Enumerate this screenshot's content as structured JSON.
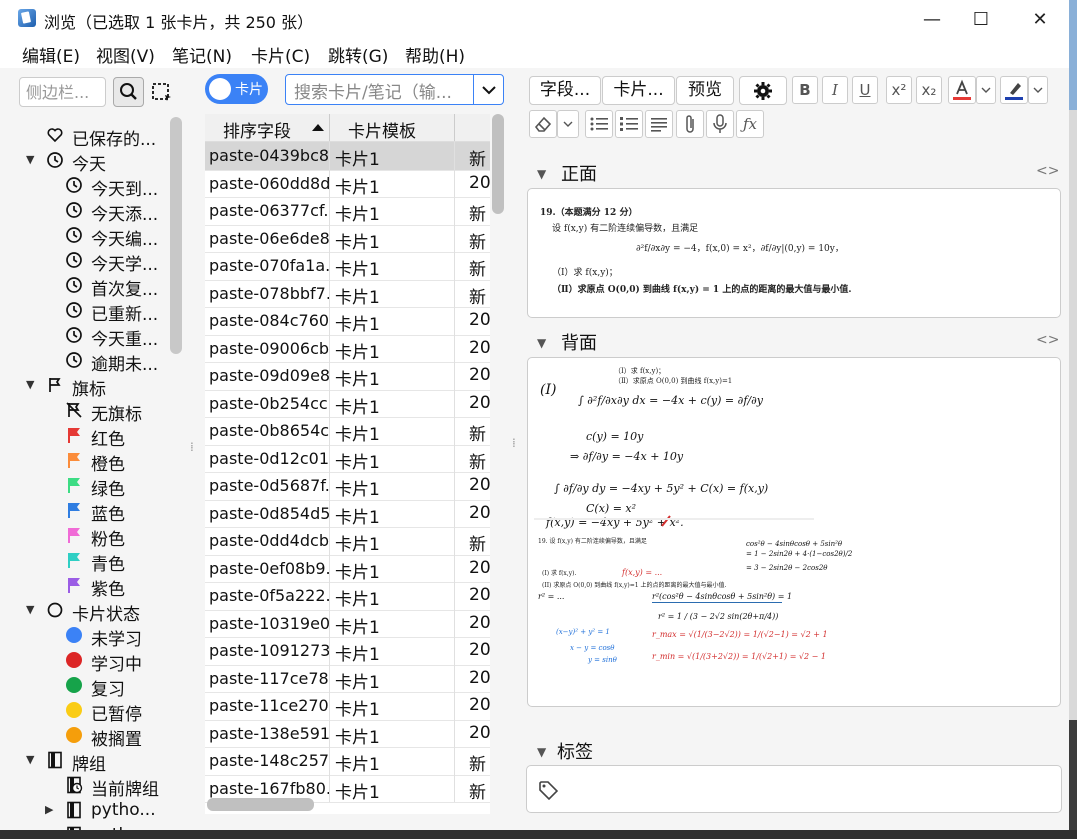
{
  "window": {
    "title": "浏览（已选取 1 张卡片，共 250 张）",
    "minimize": "—",
    "maximize": "☐",
    "close": "✕"
  },
  "menu": [
    "编辑(E)",
    "视图(V)",
    "笔记(N)",
    "卡片(C)",
    "跳转(G)",
    "帮助(H)"
  ],
  "sidebar": {
    "search_placeholder": "侧边栏...",
    "items": [
      {
        "label": "已保存的...",
        "icon": "heart-icon",
        "indent": 1
      },
      {
        "label": "今天",
        "icon": "clock-icon",
        "indent": 1,
        "expanded": true
      },
      {
        "label": "今天到...",
        "icon": "clock-icon",
        "indent": 2
      },
      {
        "label": "今天添...",
        "icon": "clock-icon",
        "indent": 2
      },
      {
        "label": "今天编...",
        "icon": "clock-icon",
        "indent": 2
      },
      {
        "label": "今天学...",
        "icon": "clock-icon",
        "indent": 2
      },
      {
        "label": "首次复...",
        "icon": "clock-icon",
        "indent": 2
      },
      {
        "label": "已重新...",
        "icon": "clock-icon",
        "indent": 2
      },
      {
        "label": "今天重...",
        "icon": "clock-icon",
        "indent": 2
      },
      {
        "label": "逾期未...",
        "icon": "clock-icon",
        "indent": 2
      },
      {
        "label": "旗标",
        "icon": "flag-outline-icon",
        "indent": 1,
        "expanded": true
      },
      {
        "label": "无旗标",
        "icon": "no-flag-icon",
        "indent": 2
      },
      {
        "label": "红色",
        "icon": "flag-icon",
        "color": "#e53935",
        "indent": 2
      },
      {
        "label": "橙色",
        "icon": "flag-icon",
        "color": "#fb8c3a",
        "indent": 2
      },
      {
        "label": "绿色",
        "icon": "flag-icon",
        "color": "#3ddc84",
        "indent": 2
      },
      {
        "label": "蓝色",
        "icon": "flag-icon",
        "color": "#2f7de1",
        "indent": 2
      },
      {
        "label": "粉色",
        "icon": "flag-icon",
        "color": "#f06bd6",
        "indent": 2
      },
      {
        "label": "青色",
        "icon": "flag-icon",
        "color": "#2fcfc4",
        "indent": 2
      },
      {
        "label": "紫色",
        "icon": "flag-icon",
        "color": "#9b5de5",
        "indent": 2
      },
      {
        "label": "卡片状态",
        "icon": "circle-outline-icon",
        "indent": 1,
        "expanded": true
      },
      {
        "label": "未学习",
        "icon": "dot-icon",
        "color": "#3b82f6",
        "indent": 2
      },
      {
        "label": "学习中",
        "icon": "dot-icon",
        "color": "#dc2626",
        "indent": 2
      },
      {
        "label": "复习",
        "icon": "dot-icon",
        "color": "#16a34a",
        "indent": 2
      },
      {
        "label": "已暂停",
        "icon": "dot-icon",
        "color": "#facc15",
        "indent": 2
      },
      {
        "label": "被搁置",
        "icon": "dot-icon",
        "color": "#f59e0b",
        "indent": 2
      },
      {
        "label": "牌组",
        "icon": "deck-icon",
        "indent": 1,
        "expanded": true
      },
      {
        "label": "当前牌组",
        "icon": "current-deck-icon",
        "indent": 2
      },
      {
        "label": "pytho...",
        "icon": "deck-icon",
        "indent": 2,
        "collapsed": true
      },
      {
        "label": "pytho...",
        "icon": "deck-icon",
        "indent": 2,
        "collapsed": true
      }
    ]
  },
  "browser": {
    "toggle_label": "卡片",
    "search_placeholder": "搜索卡片/笔记（输...",
    "columns": [
      "排序字段",
      "卡片模板",
      ""
    ],
    "rows": [
      {
        "field": "paste-0439bc8...",
        "template": "卡片1",
        "due": "新",
        "selected": true
      },
      {
        "field": "paste-060dd8d...",
        "template": "卡片1",
        "due": "20"
      },
      {
        "field": "paste-06377cf...",
        "template": "卡片1",
        "due": "新"
      },
      {
        "field": "paste-06e6de8...",
        "template": "卡片1",
        "due": "新"
      },
      {
        "field": "paste-070fa1a...",
        "template": "卡片1",
        "due": "新"
      },
      {
        "field": "paste-078bbf7...",
        "template": "卡片1",
        "due": "新"
      },
      {
        "field": "paste-084c760...",
        "template": "卡片1",
        "due": "20"
      },
      {
        "field": "paste-09006cb...",
        "template": "卡片1",
        "due": "20"
      },
      {
        "field": "paste-09d09e8...",
        "template": "卡片1",
        "due": "20"
      },
      {
        "field": "paste-0b254cc...",
        "template": "卡片1",
        "due": "20"
      },
      {
        "field": "paste-0b8654c...",
        "template": "卡片1",
        "due": "新"
      },
      {
        "field": "paste-0d12c01...",
        "template": "卡片1",
        "due": "新"
      },
      {
        "field": "paste-0d5687f...",
        "template": "卡片1",
        "due": "20"
      },
      {
        "field": "paste-0d854d5...",
        "template": "卡片1",
        "due": "20"
      },
      {
        "field": "paste-0dd4dcb...",
        "template": "卡片1",
        "due": "新"
      },
      {
        "field": "paste-0ef08b9...",
        "template": "卡片1",
        "due": "20"
      },
      {
        "field": "paste-0f5a222...",
        "template": "卡片1",
        "due": "20"
      },
      {
        "field": "paste-10319e0...",
        "template": "卡片1",
        "due": "20"
      },
      {
        "field": "paste-1091273...",
        "template": "卡片1",
        "due": "20"
      },
      {
        "field": "paste-117ce78...",
        "template": "卡片1",
        "due": "20"
      },
      {
        "field": "paste-11ce270...",
        "template": "卡片1",
        "due": "20"
      },
      {
        "field": "paste-138e591...",
        "template": "卡片1",
        "due": "20"
      },
      {
        "field": "paste-148c257...",
        "template": "卡片1",
        "due": "新"
      },
      {
        "field": "paste-167fb80...",
        "template": "卡片1",
        "due": "新"
      }
    ]
  },
  "editor": {
    "buttons": {
      "fields": "字段...",
      "cards": "卡片...",
      "preview": "预览"
    },
    "format_icons": [
      "settings-gear-icon",
      "bold-icon",
      "italic-icon",
      "underline-icon",
      "superscript-icon",
      "subscript-icon",
      "text-color-icon",
      "dropdown-icon",
      "highlight-icon",
      "dropdown-icon",
      "eraser-icon",
      "dropdown-icon",
      "bullet-list-icon",
      "numbered-list-icon",
      "align-icon",
      "attach-icon",
      "record-audio-icon",
      "math-fx-icon"
    ],
    "format_labels": {
      "bold": "B",
      "italic": "I",
      "underline": "U",
      "sup": "x²",
      "sub": "x₂"
    },
    "text_color": "#e53935",
    "highlight_color": "#1e40af",
    "front_label": "正面",
    "back_label": "背面",
    "tags_label": "标签",
    "front": {
      "line1": "19.（本题满分 12 分）",
      "line2": "设 f(x,y) 有二阶连续偏导数，且满足",
      "line3": "∂²f/∂x∂y = −4，f(x,0) = x²，∂f/∂y|(0,y) = 10y，",
      "line4": "（Ⅰ）求 f(x,y)；",
      "line5": "（Ⅱ）求原点 O(0,0) 到曲线 f(x,y) = 1 上的点的距离的最大值与最小值."
    },
    "back": {
      "top1": "（Ⅰ）求 f(x,y)；",
      "top2": "（Ⅱ）求原点 O(0,0) 到曲线 f(x,y)=1",
      "h1": "(I)",
      "h2": "∫ ∂²f/∂x∂y dx = −4x + c(y) = ∂f/∂y",
      "h3": "c(y) = 10y",
      "h4": "⇒ ∂f/∂y = −4x + 10y",
      "h5": "∫ ∂f/∂y dy = −4xy + 5y² + C(x) = f(x,y)",
      "h6": "C(x) = x²",
      "h7": "f(x,y) = −4xy + 5y² + x².",
      "p1": "19. 设 f(x,y) 有二阶连续偏导数，且满足",
      "p2": "(I) 求 f(x,y).",
      "p3": "(II) 求原点 O(0,0) 到曲线 f(x,y)=1 上的点的距离的最大值与最小值.",
      "r1": "cos²θ − 4sinθcosθ + 5sin²θ",
      "r2": "= 1 − 2sin2θ + 4·(1−cos2θ)/2",
      "r3": "= 3 − 2sin2θ − 2cos2θ",
      "g1": "r² = ...",
      "g2": "r²(cos²θ − 4sinθcosθ + 5sin²θ) = 1",
      "g3": "r² = 1 / (3 − 2√2 sin(2θ+π/4))",
      "b1": "(x−y)² + y² = 1",
      "b2": "x − y = cosθ",
      "b3": "y = sinθ",
      "m1": "r_max = √(1/(3−2√2)) = 1/(√2−1) = √2 + 1",
      "m2": "r_min = √(1/(3+2√2)) = 1/(√2+1) = √2 − 1",
      "mark": "f(x,y) = ..."
    }
  }
}
